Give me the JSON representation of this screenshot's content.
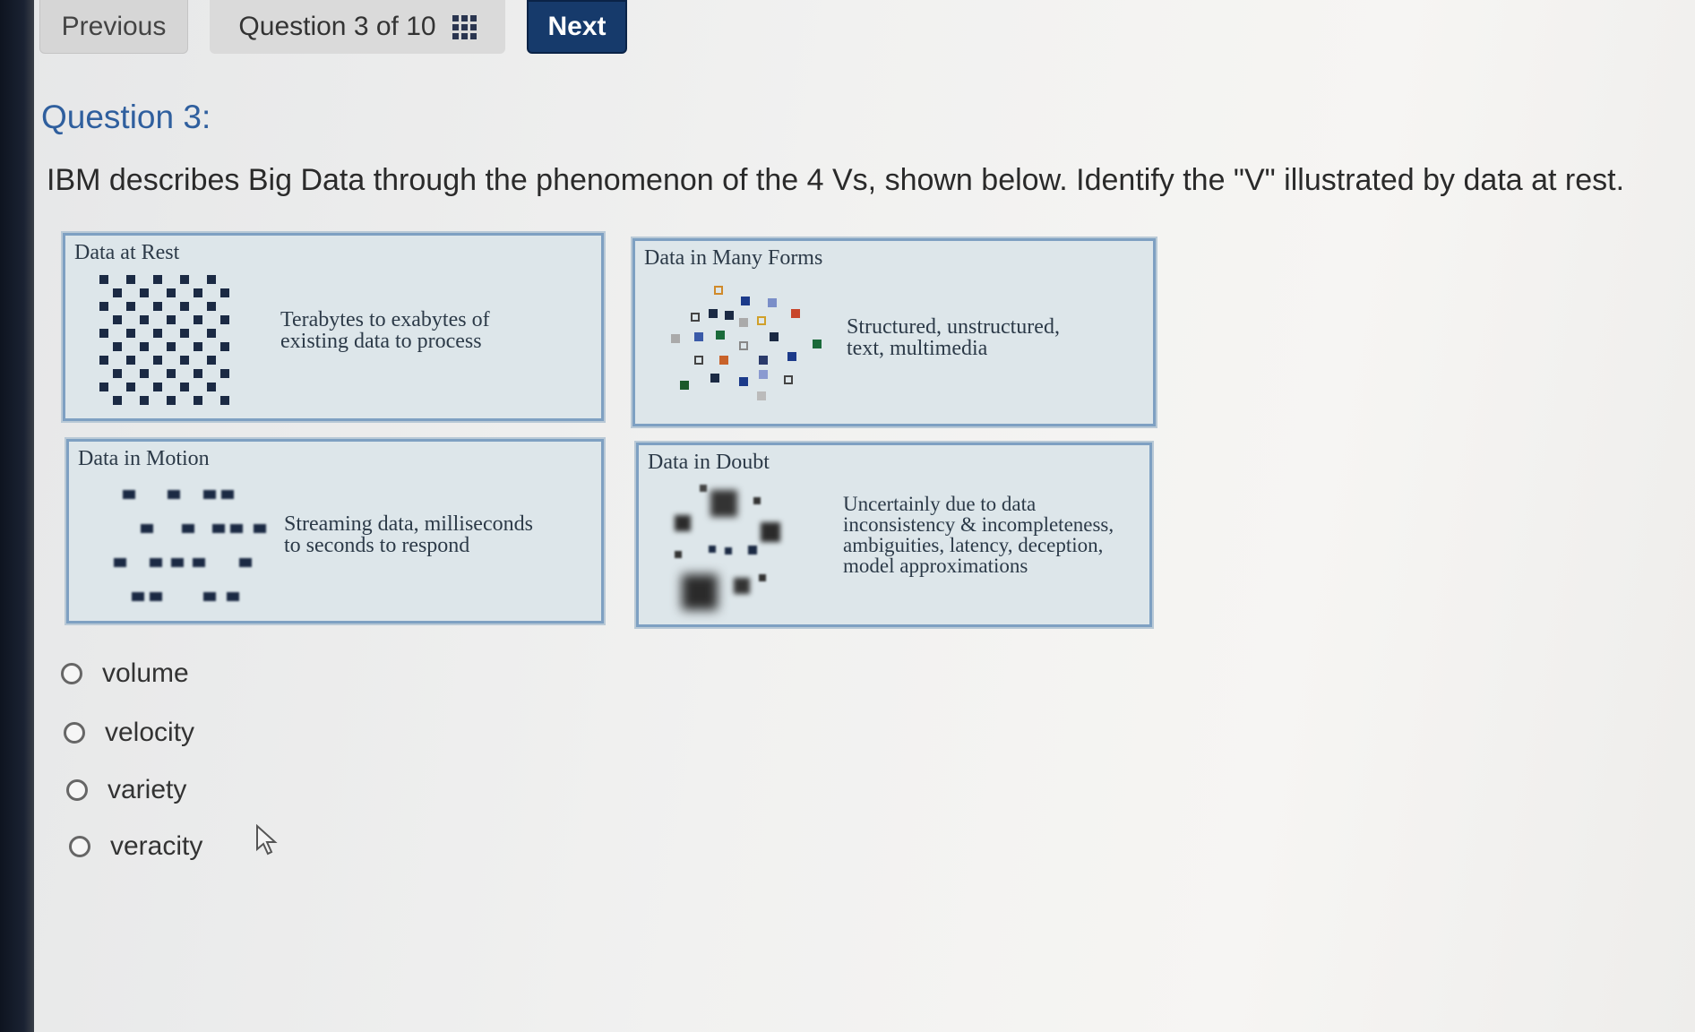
{
  "toolbar": {
    "previous_label": "Previous",
    "progress_label": "Question 3 of 10",
    "progress_icon": "grid-menu-icon",
    "next_label": "Next"
  },
  "question": {
    "title": "Question 3:",
    "text": "IBM describes Big Data through the phenomenon of the 4 Vs, shown below. Identify the \"V\" illustrated by data at rest."
  },
  "figure": {
    "panels": [
      {
        "title": "Data at Rest",
        "desc_line1": "Terabytes to exabytes of",
        "desc_line2": "existing data to process"
      },
      {
        "title": "Data in Many Forms",
        "desc_line1": "Structured, unstructured,",
        "desc_line2": "text, multimedia"
      },
      {
        "title": "Data in Motion",
        "desc_line1": "Streaming data, milliseconds",
        "desc_line2": "to seconds to respond"
      },
      {
        "title": "Data in Doubt",
        "desc_line1": "Uncertainly due to data",
        "desc_line2": "inconsistency & incompleteness,",
        "desc_line3": "ambiguities, latency, deception,",
        "desc_line4": "model approximations"
      }
    ]
  },
  "options": [
    {
      "label": "volume",
      "selected": false
    },
    {
      "label": "velocity",
      "selected": false
    },
    {
      "label": "variety",
      "selected": false
    },
    {
      "label": "veracity",
      "selected": false
    }
  ],
  "colors": {
    "accent": "#163a6b",
    "title_blue": "#2f5f9e",
    "panel_border": "#7ea0c2"
  }
}
